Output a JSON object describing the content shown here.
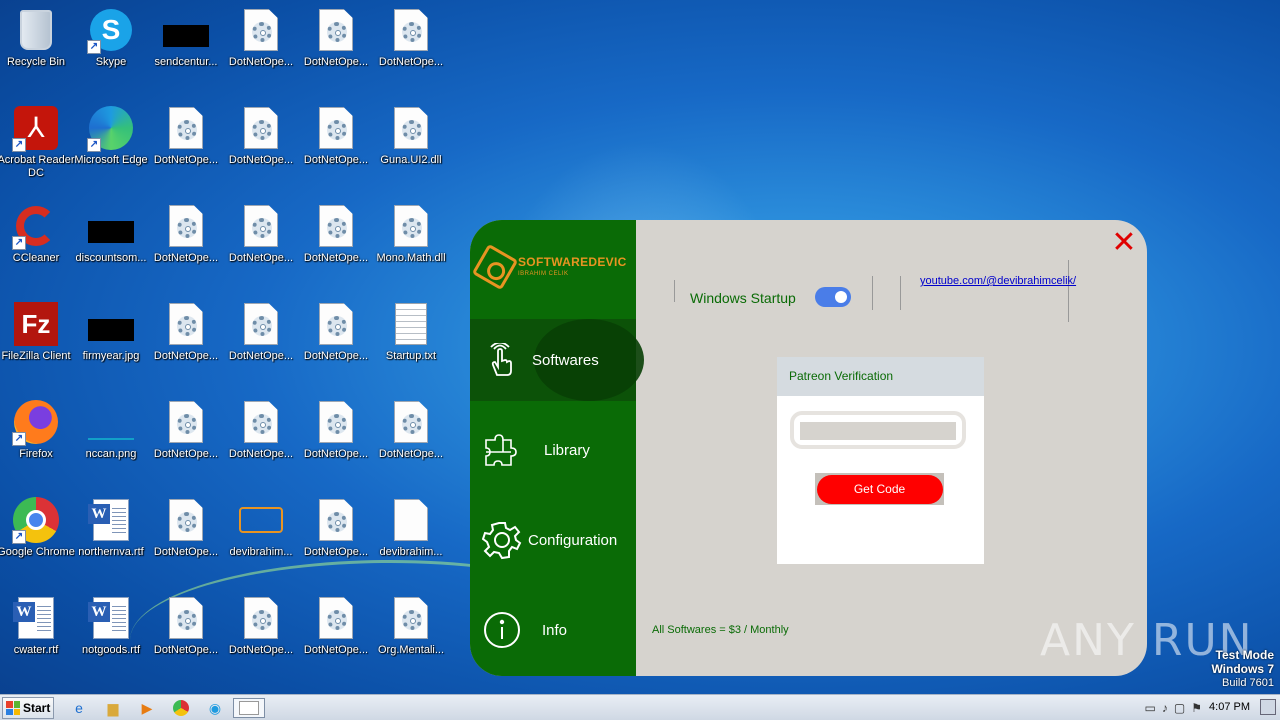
{
  "desktop": {
    "icons": [
      {
        "label": "Recycle Bin"
      },
      {
        "label": "Skype"
      },
      {
        "label": "sendcentur..."
      },
      {
        "label": "DotNetOpe..."
      },
      {
        "label": "DotNetOpe..."
      },
      {
        "label": "DotNetOpe..."
      },
      {
        "label": "Acrobat Reader DC"
      },
      {
        "label": "Microsoft Edge"
      },
      {
        "label": "DotNetOpe..."
      },
      {
        "label": "DotNetOpe..."
      },
      {
        "label": "DotNetOpe..."
      },
      {
        "label": "Guna.UI2.dll"
      },
      {
        "label": "CCleaner"
      },
      {
        "label": "discountsom..."
      },
      {
        "label": "DotNetOpe..."
      },
      {
        "label": "DotNetOpe..."
      },
      {
        "label": "DotNetOpe..."
      },
      {
        "label": "Mono.Math.dll"
      },
      {
        "label": "FileZilla Client"
      },
      {
        "label": "firmyear.jpg"
      },
      {
        "label": "DotNetOpe..."
      },
      {
        "label": "DotNetOpe..."
      },
      {
        "label": "DotNetOpe..."
      },
      {
        "label": "Startup.txt"
      },
      {
        "label": "Firefox"
      },
      {
        "label": "nccan.png"
      },
      {
        "label": "DotNetOpe..."
      },
      {
        "label": "DotNetOpe..."
      },
      {
        "label": "DotNetOpe..."
      },
      {
        "label": "DotNetOpe..."
      },
      {
        "label": "Google Chrome"
      },
      {
        "label": "northernva.rtf"
      },
      {
        "label": "DotNetOpe..."
      },
      {
        "label": "devibrahim..."
      },
      {
        "label": "DotNetOpe..."
      },
      {
        "label": "devibrahim..."
      },
      {
        "label": "cwater.rtf"
      },
      {
        "label": "notgoods.rtf"
      },
      {
        "label": "DotNetOpe..."
      },
      {
        "label": "DotNetOpe..."
      },
      {
        "label": "DotNetOpe..."
      },
      {
        "label": "Org.Mentali..."
      }
    ]
  },
  "app": {
    "logo_title": "SOFTWAREDEVIC",
    "logo_subtitle": "IBRAHIM CELIK",
    "nav": [
      {
        "label": "Softwares",
        "icon": "touch-icon",
        "active": true
      },
      {
        "label": "Library",
        "icon": "puzzle-icon",
        "active": false
      },
      {
        "label": "Configuration",
        "icon": "gear-icon",
        "active": false
      },
      {
        "label": "Info",
        "icon": "info-icon",
        "active": false
      }
    ],
    "close_label": "✕",
    "startup_label": "Windows Startup",
    "startup_toggle": true,
    "youtube_link": "youtube.com/@devibrahimcelik/",
    "patreon": {
      "header": "Patreon Verification",
      "input_value": "",
      "button_label": "Get Code"
    },
    "price_text": "All Softwares = $3 / Monthly",
    "colors": {
      "sidebar": "#0a6b06",
      "accent": "#e89422",
      "button": "#ff0000",
      "toggle": "#4a7de8"
    }
  },
  "watermark": "ANY RUN",
  "os_info": {
    "line1": "Test Mode",
    "line2": "Windows 7",
    "line3": "Build 7601"
  },
  "taskbar": {
    "start_label": "Start",
    "clock": "4:07 PM"
  }
}
